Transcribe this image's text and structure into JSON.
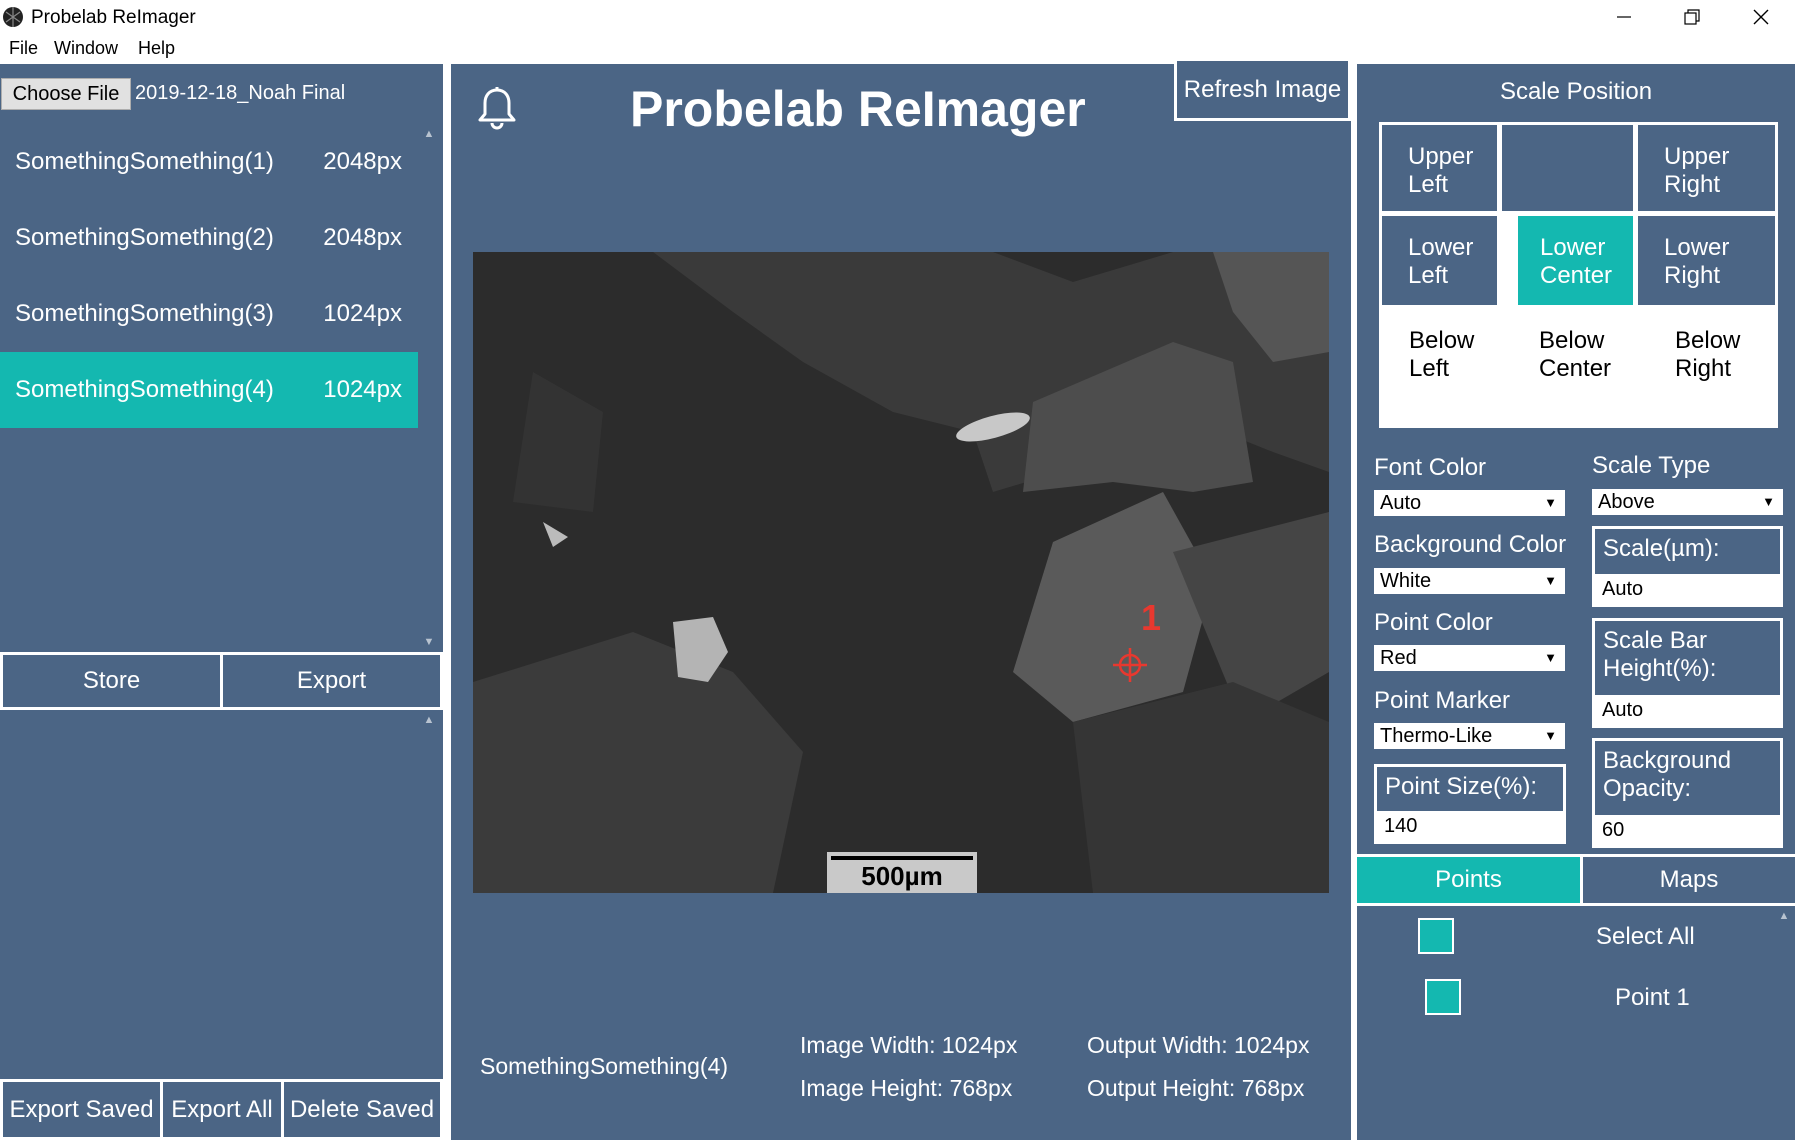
{
  "window": {
    "title": "Probelab ReImager"
  },
  "menu": [
    "File",
    "Window",
    "Help"
  ],
  "left": {
    "choose_file_label": "Choose File",
    "file_name": "2019-12-18_Noah Final",
    "files": [
      {
        "name": "SomethingSomething(1)",
        "size": "2048px",
        "selected": false
      },
      {
        "name": "SomethingSomething(2)",
        "size": "2048px",
        "selected": false
      },
      {
        "name": "SomethingSomething(3)",
        "size": "1024px",
        "selected": false
      },
      {
        "name": "SomethingSomething(4)",
        "size": "1024px",
        "selected": true
      }
    ],
    "store_label": "Store",
    "export_label": "Export",
    "export_saved_label": "Export Saved",
    "export_all_label": "Export All",
    "delete_saved_label": "Delete Saved"
  },
  "center": {
    "heading": "Probelab ReImager",
    "refresh_label": "Refresh Image",
    "scale_text": "500µm",
    "point_number": "1",
    "current_image": "SomethingSomething(4)",
    "image_width": "Image Width: 1024px",
    "image_height": "Image Height: 768px",
    "output_width": "Output Width: 1024px",
    "output_height": "Output Height: 768px"
  },
  "right": {
    "scale_position_title": "Scale Position",
    "positions": {
      "upper_left": "Upper Left",
      "upper_right": "Upper Right",
      "lower_left": "Lower Left",
      "lower_center": "Lower Center",
      "lower_right": "Lower Right",
      "below_left": "Below Left",
      "below_center": "Below Center",
      "below_right": "Below Right"
    },
    "selected_position": "Lower Center",
    "font_color_label": "Font Color",
    "font_color_value": "Auto",
    "background_color_label": "Background Color",
    "background_color_value": "White",
    "point_color_label": "Point Color",
    "point_color_value": "Red",
    "point_marker_label": "Point Marker",
    "point_marker_value": "Thermo-Like",
    "point_size_label": "Point Size(%):",
    "point_size_value": "140",
    "scale_type_label": "Scale Type",
    "scale_type_value": "Above",
    "scale_um_label": "Scale(µm):",
    "scale_um_value": "Auto",
    "scale_bar_height_label": "Scale Bar Height(%):",
    "scale_bar_height_value": "Auto",
    "background_opacity_label": "Background Opacity:",
    "background_opacity_value": "60",
    "tab_points": "Points",
    "tab_maps": "Maps",
    "select_all_label": "Select All",
    "point_1_label": "Point 1"
  },
  "colors": {
    "panel": "#4b6585",
    "accent": "#14b8b0",
    "marker": "#e8382f"
  }
}
